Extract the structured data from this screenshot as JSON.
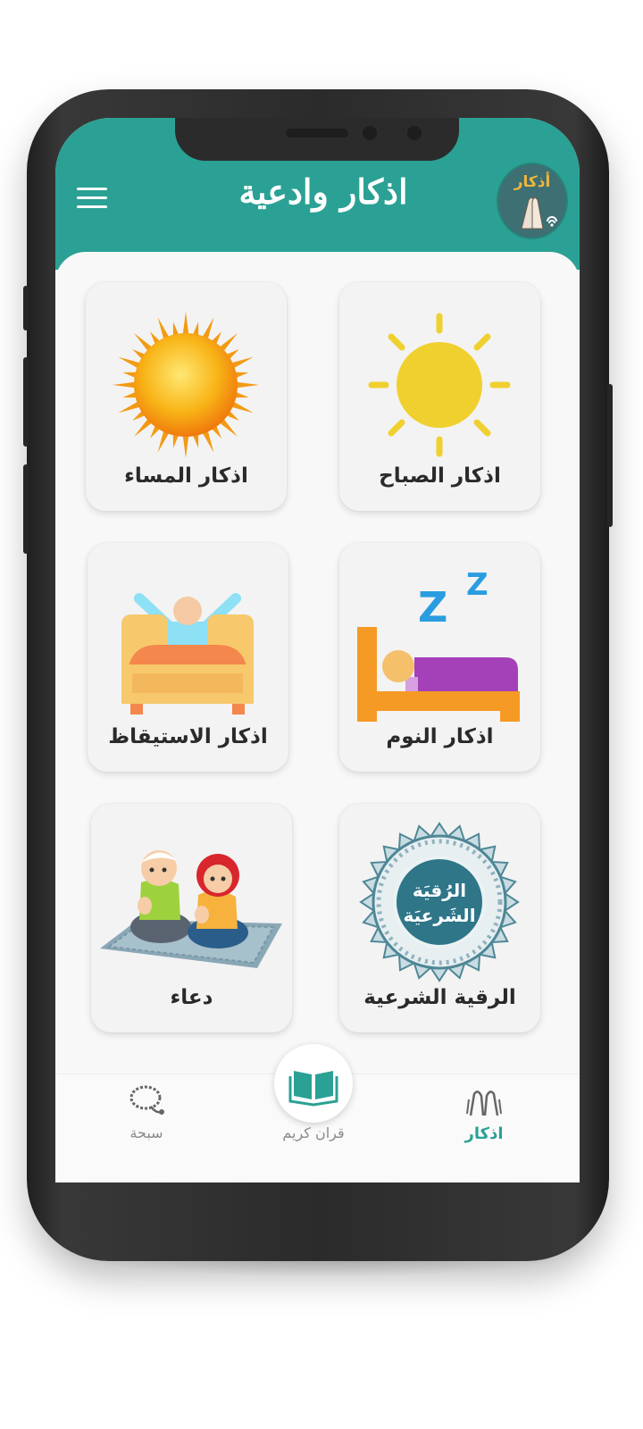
{
  "app": {
    "title": "اذكار وادعية",
    "logo_text": "أذكار"
  },
  "cards": [
    {
      "label": "اذكار المساء",
      "icon": "evening-sun-icon"
    },
    {
      "label": "اذكار الصباح",
      "icon": "morning-sun-icon"
    },
    {
      "label": "اذكار الاستيقاظ",
      "icon": "wake-up-bed-icon"
    },
    {
      "label": "اذكار النوم",
      "icon": "sleep-bed-icon"
    },
    {
      "label": "دعاء",
      "icon": "kids-praying-icon"
    },
    {
      "label": "الرقية الشرعية",
      "icon": "ruqyah-emblem-icon",
      "emblem_text": [
        "الرُقيَة",
        "الشَرعيَة"
      ]
    }
  ],
  "bottom_nav": {
    "tasbih": {
      "label": "سبحة",
      "icon": "prayer-beads-icon"
    },
    "quran": {
      "label": "قران كريم",
      "icon": "open-book-icon"
    },
    "azkar": {
      "label": "اذكار",
      "icon": "praying-hands-icon",
      "active": true
    }
  },
  "colors": {
    "primary": "#2aa194",
    "active_nav": "#2aa194",
    "inactive_nav": "#8a8a8a"
  }
}
